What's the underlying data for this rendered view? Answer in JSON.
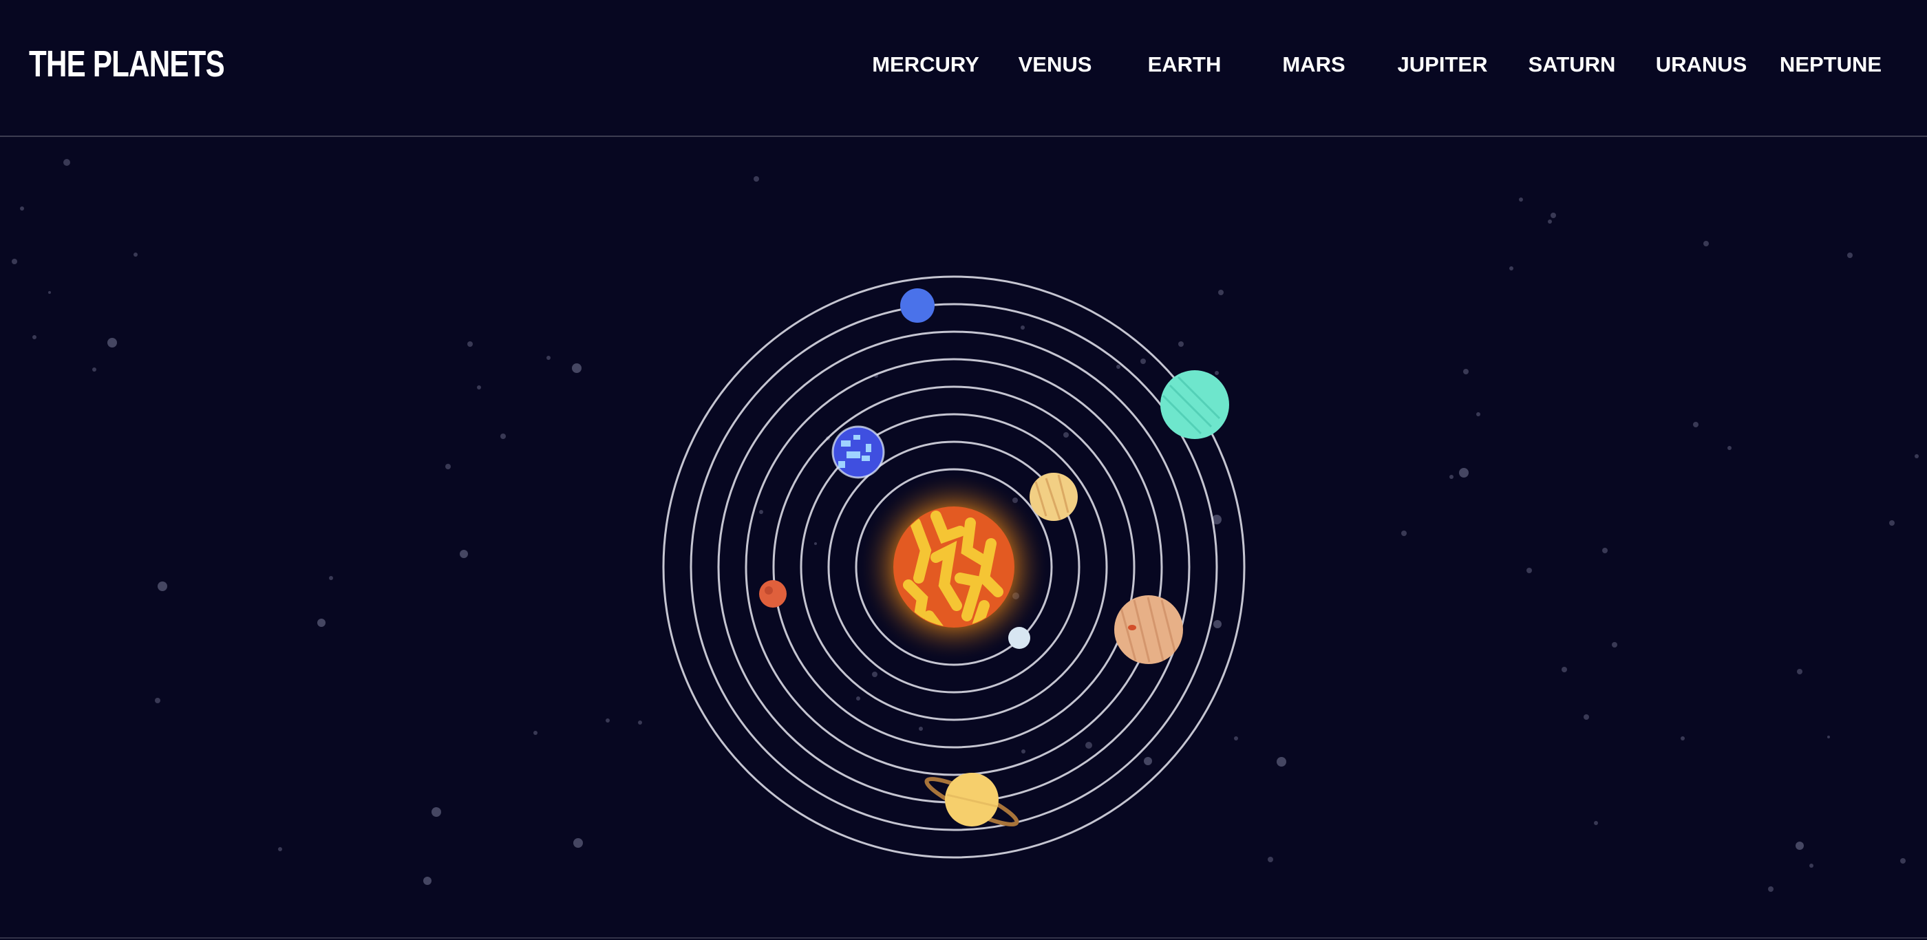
{
  "app": {
    "logo": "THE PLANETS"
  },
  "nav": {
    "items": [
      {
        "label": "MERCURY"
      },
      {
        "label": "VENUS"
      },
      {
        "label": "EARTH"
      },
      {
        "label": "MARS"
      },
      {
        "label": "JUPITER"
      },
      {
        "label": "SATURN"
      },
      {
        "label": "URANUS"
      },
      {
        "label": "NEPTUNE"
      }
    ]
  },
  "colors": {
    "background": "#070721",
    "orbit": "#e6e6f0",
    "sun_core": "#e35a22",
    "sun_glow": "#f59a1b",
    "sun_streaks": "#f5c534"
  },
  "solar_system": {
    "planets": [
      {
        "name": "mercury",
        "icon": "mercury-icon",
        "color": "#d8e6f2"
      },
      {
        "name": "venus",
        "icon": "venus-icon",
        "color": "#f2cf84"
      },
      {
        "name": "earth",
        "icon": "earth-icon",
        "color": "#4f63e8"
      },
      {
        "name": "mars",
        "icon": "mars-icon",
        "color": "#e0603c"
      },
      {
        "name": "jupiter",
        "icon": "jupiter-icon",
        "color": "#e7b087"
      },
      {
        "name": "saturn",
        "icon": "saturn-icon",
        "color": "#f6cf6c"
      },
      {
        "name": "uranus",
        "icon": "uranus-icon",
        "color": "#6ee6cc"
      },
      {
        "name": "neptune",
        "icon": "neptune-icon",
        "color": "#4a72ea"
      }
    ]
  }
}
